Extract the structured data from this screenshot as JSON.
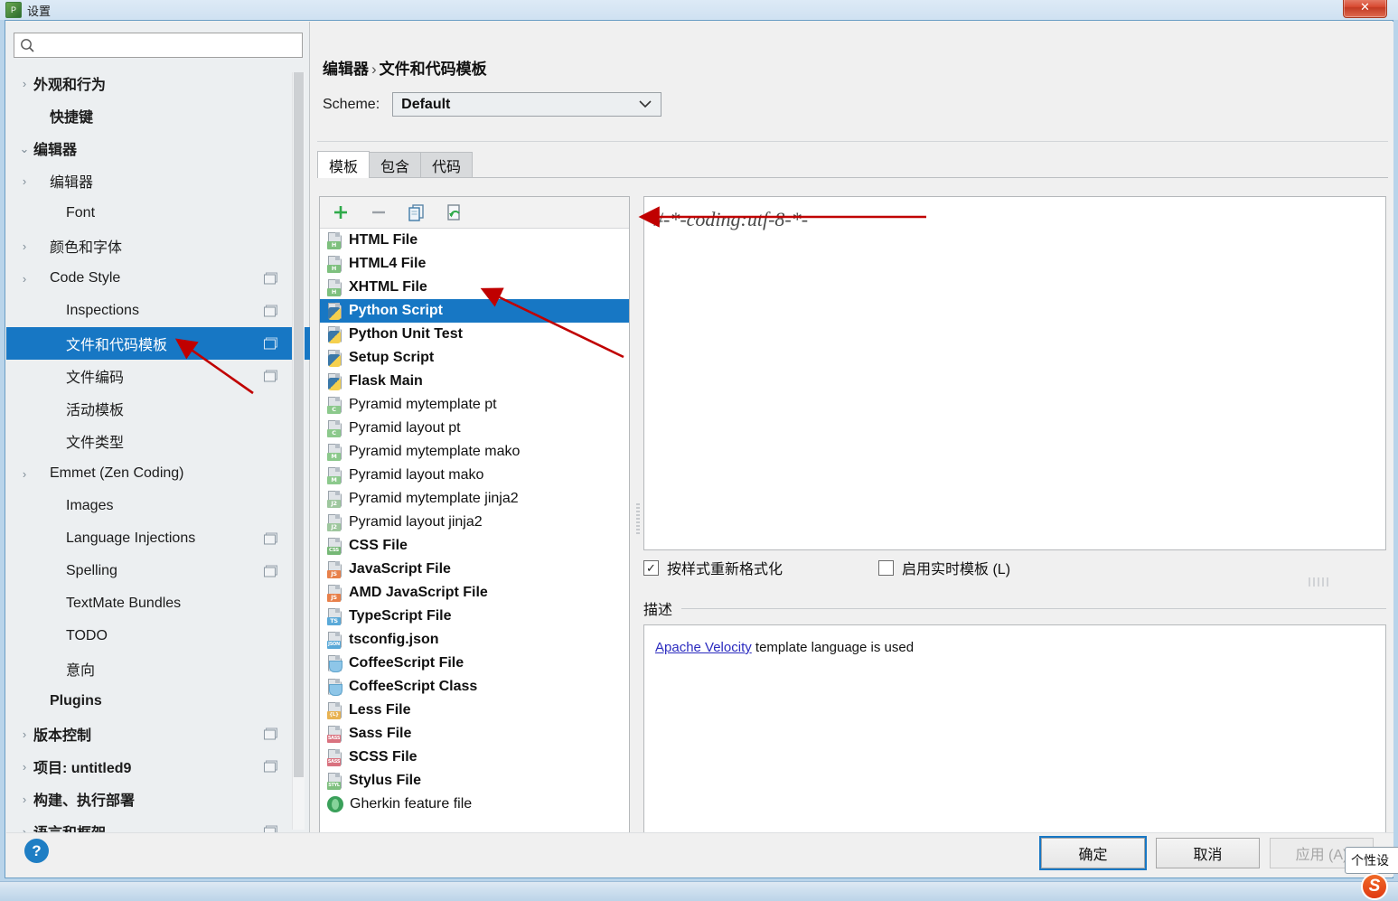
{
  "window": {
    "title": "设置",
    "icon": "app-icon",
    "close_label": "✕"
  },
  "sidebar": {
    "search": {
      "value": "",
      "placeholder": "",
      "icon": "search-icon"
    },
    "items": [
      {
        "label": "外观和行为",
        "arrow": "›",
        "bold": true,
        "indent": 0,
        "copy": false,
        "selected": false
      },
      {
        "label": "快捷键",
        "arrow": "",
        "bold": true,
        "indent": 1,
        "copy": false,
        "selected": false
      },
      {
        "label": "编辑器",
        "arrow": "⌄",
        "bold": true,
        "indent": 0,
        "copy": false,
        "selected": false
      },
      {
        "label": "编辑器",
        "arrow": "›",
        "bold": false,
        "indent": 1,
        "copy": false,
        "selected": false
      },
      {
        "label": "Font",
        "arrow": "",
        "bold": false,
        "indent": 2,
        "copy": false,
        "selected": false
      },
      {
        "label": "颜色和字体",
        "arrow": "›",
        "bold": false,
        "indent": 1,
        "copy": false,
        "selected": false
      },
      {
        "label": "Code Style",
        "arrow": "›",
        "bold": false,
        "indent": 1,
        "copy": true,
        "selected": false
      },
      {
        "label": "Inspections",
        "arrow": "",
        "bold": false,
        "indent": 2,
        "copy": true,
        "selected": false
      },
      {
        "label": "文件和代码模板",
        "arrow": "",
        "bold": false,
        "indent": 2,
        "copy": true,
        "selected": true
      },
      {
        "label": "文件编码",
        "arrow": "",
        "bold": false,
        "indent": 2,
        "copy": true,
        "selected": false
      },
      {
        "label": "活动模板",
        "arrow": "",
        "bold": false,
        "indent": 2,
        "copy": false,
        "selected": false
      },
      {
        "label": "文件类型",
        "arrow": "",
        "bold": false,
        "indent": 2,
        "copy": false,
        "selected": false
      },
      {
        "label": "Emmet (Zen Coding)",
        "arrow": "›",
        "bold": false,
        "indent": 1,
        "copy": false,
        "selected": false
      },
      {
        "label": "Images",
        "arrow": "",
        "bold": false,
        "indent": 2,
        "copy": false,
        "selected": false
      },
      {
        "label": "Language Injections",
        "arrow": "",
        "bold": false,
        "indent": 2,
        "copy": true,
        "selected": false
      },
      {
        "label": "Spelling",
        "arrow": "",
        "bold": false,
        "indent": 2,
        "copy": true,
        "selected": false
      },
      {
        "label": "TextMate Bundles",
        "arrow": "",
        "bold": false,
        "indent": 2,
        "copy": false,
        "selected": false
      },
      {
        "label": "TODO",
        "arrow": "",
        "bold": false,
        "indent": 2,
        "copy": false,
        "selected": false
      },
      {
        "label": "意向",
        "arrow": "",
        "bold": false,
        "indent": 2,
        "copy": false,
        "selected": false
      },
      {
        "label": "Plugins",
        "arrow": "",
        "bold": true,
        "indent": 1,
        "copy": false,
        "selected": false
      },
      {
        "label": "版本控制",
        "arrow": "›",
        "bold": true,
        "indent": 0,
        "copy": true,
        "selected": false
      },
      {
        "label": "项目: untitled9",
        "arrow": "›",
        "bold": true,
        "indent": 0,
        "copy": true,
        "selected": false
      },
      {
        "label": "构建、执行部署",
        "arrow": "›",
        "bold": true,
        "indent": 0,
        "copy": false,
        "selected": false
      },
      {
        "label": "语言和框架",
        "arrow": "›",
        "bold": true,
        "indent": 0,
        "copy": true,
        "selected": false
      }
    ]
  },
  "main": {
    "breadcrumb": {
      "parent": "编辑器",
      "separator": "›",
      "current": "文件和代码模板"
    },
    "scheme": {
      "label": "Scheme:",
      "value": "Default",
      "chevron": "⌄"
    },
    "tabs": [
      {
        "label": "模板",
        "active": true
      },
      {
        "label": "包含",
        "active": false
      },
      {
        "label": "代码",
        "active": false
      }
    ],
    "toolbar": [
      {
        "name": "add-template-button",
        "glyph": "add-icon"
      },
      {
        "name": "remove-template-button",
        "glyph": "remove-icon"
      },
      {
        "name": "copy-template-button",
        "glyph": "copy-icon"
      },
      {
        "name": "reset-template-button",
        "glyph": "reset-icon"
      }
    ],
    "templates": [
      {
        "label": "HTML File",
        "icon": "html",
        "badge": "H",
        "bold": true,
        "selected": false
      },
      {
        "label": "HTML4 File",
        "icon": "html",
        "badge": "H",
        "bold": true,
        "selected": false
      },
      {
        "label": "XHTML File",
        "icon": "xhtml",
        "badge": "H",
        "bold": true,
        "selected": false
      },
      {
        "label": "Python Script",
        "icon": "python",
        "badge": "",
        "bold": true,
        "selected": true
      },
      {
        "label": "Python Unit Test",
        "icon": "python",
        "badge": "",
        "bold": true,
        "selected": false
      },
      {
        "label": "Setup Script",
        "icon": "python",
        "badge": "",
        "bold": true,
        "selected": false
      },
      {
        "label": "Flask Main",
        "icon": "python",
        "badge": "",
        "bold": true,
        "selected": false
      },
      {
        "label": "Pyramid mytemplate pt",
        "icon": "chameleon",
        "badge": "C",
        "bold": false,
        "selected": false
      },
      {
        "label": "Pyramid layout pt",
        "icon": "chameleon",
        "badge": "C",
        "bold": false,
        "selected": false
      },
      {
        "label": "Pyramid mytemplate mako",
        "icon": "mako",
        "badge": "M",
        "bold": false,
        "selected": false
      },
      {
        "label": "Pyramid layout mako",
        "icon": "mako",
        "badge": "M",
        "bold": false,
        "selected": false
      },
      {
        "label": "Pyramid mytemplate jinja2",
        "icon": "jinja",
        "badge": "J2",
        "bold": false,
        "selected": false
      },
      {
        "label": "Pyramid layout jinja2",
        "icon": "jinja",
        "badge": "J2",
        "bold": false,
        "selected": false
      },
      {
        "label": "CSS File",
        "icon": "css",
        "badge": "CSS",
        "bold": true,
        "selected": false
      },
      {
        "label": "JavaScript File",
        "icon": "js",
        "badge": "JS",
        "bold": true,
        "selected": false
      },
      {
        "label": "AMD JavaScript File",
        "icon": "js",
        "badge": "JS",
        "bold": true,
        "selected": false
      },
      {
        "label": "TypeScript File",
        "icon": "ts",
        "badge": "TS",
        "bold": true,
        "selected": false
      },
      {
        "label": "tsconfig.json",
        "icon": "json",
        "badge": "JSON",
        "bold": true,
        "selected": false
      },
      {
        "label": "CoffeeScript File",
        "icon": "coffee",
        "badge": "",
        "bold": true,
        "selected": false
      },
      {
        "label": "CoffeeScript Class",
        "icon": "coffee",
        "badge": "",
        "bold": true,
        "selected": false
      },
      {
        "label": "Less File",
        "icon": "less",
        "badge": "{L}",
        "bold": true,
        "selected": false
      },
      {
        "label": "Sass File",
        "icon": "sass",
        "badge": "SASS",
        "bold": true,
        "selected": false
      },
      {
        "label": "SCSS File",
        "icon": "sass",
        "badge": "SASS",
        "bold": true,
        "selected": false
      },
      {
        "label": "Stylus File",
        "icon": "stylus",
        "badge": "STYL",
        "bold": true,
        "selected": false
      },
      {
        "label": "Gherkin feature file",
        "icon": "gherkin",
        "badge": "",
        "bold": false,
        "selected": false
      }
    ],
    "editor": {
      "content": "#-*-coding:utf-8-*-"
    },
    "options": [
      {
        "label": "按样式重新格式化",
        "checked": true,
        "mark": "✓"
      },
      {
        "label": "启用实时模板 (L)",
        "checked": false,
        "mark": ""
      }
    ],
    "description": {
      "title": "描述",
      "link_text": "Apache Velocity",
      "text": " template language is used"
    }
  },
  "footer": {
    "help": "?",
    "ok": "确定",
    "cancel": "取消",
    "apply": "应用 (A)"
  },
  "overlay": {
    "tooltip": "个性设",
    "ime": "S"
  },
  "colors": {
    "selection_blue": "#1777c4",
    "annotation_red": "#c00000",
    "link_blue": "#2b2bbf"
  }
}
